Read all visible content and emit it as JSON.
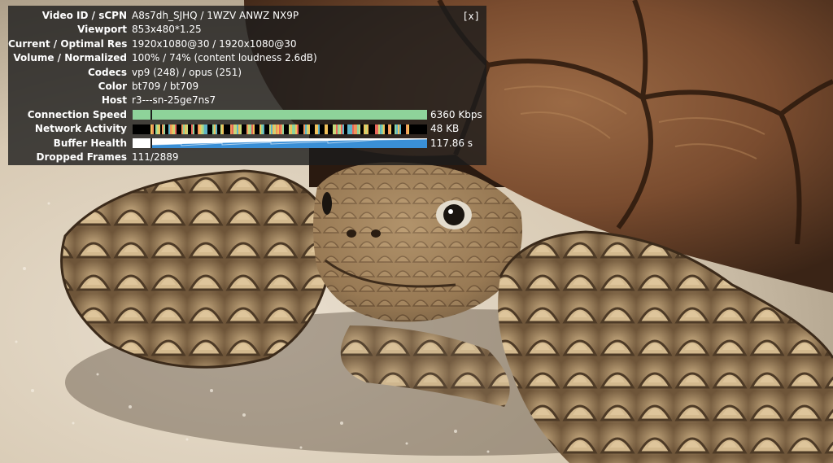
{
  "stats": {
    "close_label": "[x]",
    "rows": [
      {
        "label": "Video ID / sCPN",
        "value": "A8s7dh_SJHQ / 1WZV ANWZ NX9P"
      },
      {
        "label": "Viewport",
        "value": "853x480*1.25"
      },
      {
        "label": "Current / Optimal Res",
        "value": "1920x1080@30 / 1920x1080@30"
      },
      {
        "label": "Volume / Normalized",
        "value": "100% / 74% (content loudness 2.6dB)"
      },
      {
        "label": "Codecs",
        "value": "vp9 (248) / opus (251)"
      },
      {
        "label": "Color",
        "value": "bt709 / bt709"
      },
      {
        "label": "Host",
        "value": "r3---sn-25ge7ns7"
      }
    ],
    "connection_speed": {
      "label": "Connection Speed",
      "value": "6360 Kbps",
      "color": "#8ed39a"
    },
    "network_activity": {
      "label": "Network Activity",
      "value": "48 KB"
    },
    "buffer_health": {
      "label": "Buffer Health",
      "value": "117.86 s",
      "color": "#3a8fd6"
    },
    "dropped_frames": {
      "label": "Dropped Frames",
      "value": "111/2889"
    }
  }
}
